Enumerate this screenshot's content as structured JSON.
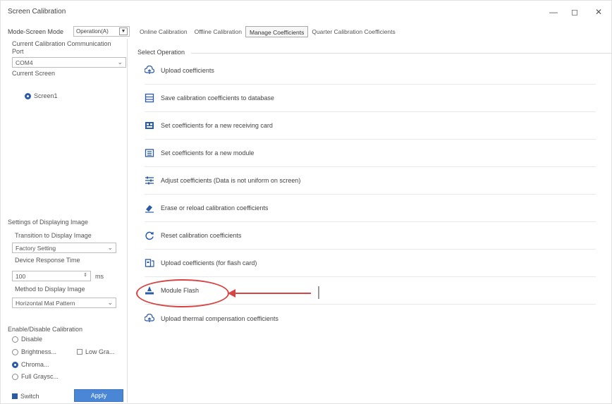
{
  "window": {
    "title": "Screen Calibration",
    "controls": {
      "minimize": "—",
      "maximize": "◻",
      "close": "✕"
    }
  },
  "toolbar": {
    "mode_label": "Mode-Screen Mode",
    "mode_value": "Operation(A)",
    "tabs": [
      {
        "label": "Online Calibration"
      },
      {
        "label": "Offline Calibration"
      },
      {
        "label": "Manage Coefficients",
        "active": true
      },
      {
        "label": "Quarter Calibration Coefficients"
      }
    ]
  },
  "left": {
    "comm_label": "Current Calibration Communication Port",
    "comm_value": "COM4",
    "current_screen_label": "Current Screen",
    "screen_option": "Screen1",
    "display_settings_title": "Settings of Displaying Image",
    "transition_label": "Transition to Display Image",
    "transition_value": "Factory Setting",
    "response_label": "Device Response Time",
    "response_value": "100",
    "response_unit": "ms",
    "method_label": "Method to Display Image",
    "method_value": "Horizontal Mat Pattern",
    "enable_title": "Enable/Disable Calibration",
    "options": [
      {
        "label": "Disable",
        "type": "radio",
        "on": false
      },
      {
        "label": "Brightness...",
        "type": "radio",
        "on": false
      },
      {
        "label": "Chroma...",
        "type": "radio",
        "on": true
      },
      {
        "label": "Full Graysc...",
        "type": "radio",
        "on": false
      },
      {
        "label": "Switch",
        "type": "check",
        "on": true
      }
    ],
    "low_gray_label": "Low Gra...",
    "apply_label": "Apply"
  },
  "right": {
    "section_title": "Select Operation",
    "operations": [
      {
        "label": "Upload coefficients",
        "icon": "upload-cloud-icon"
      },
      {
        "label": "Save calibration coefficients to database",
        "icon": "database-save-icon"
      },
      {
        "label": "Set coefficients for a new receiving card",
        "icon": "receiving-card-icon"
      },
      {
        "label": "Set coefficients for a new module",
        "icon": "module-icon"
      },
      {
        "label": "Adjust coefficients (Data is not uniform on screen)",
        "icon": "adjust-sliders-icon"
      },
      {
        "label": "Erase or reload calibration coefficients",
        "icon": "eraser-icon"
      },
      {
        "label": "Reset calibration coefficients",
        "icon": "reset-icon"
      },
      {
        "label": "Upload coefficients (for flash card)",
        "icon": "flash-card-icon"
      },
      {
        "label": "Module Flash",
        "icon": "module-flash-icon"
      },
      {
        "label": "Upload thermal compensation coefficients",
        "icon": "upload-thermal-icon"
      }
    ]
  },
  "colors": {
    "accent": "#2b5aa8",
    "button": "#4a86d6",
    "annotation": "#d64545"
  }
}
